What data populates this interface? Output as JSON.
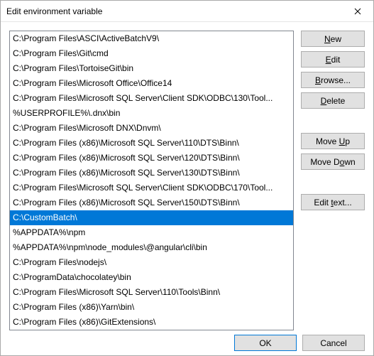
{
  "window": {
    "title": "Edit environment variable"
  },
  "paths": [
    {
      "text": "C:\\Program Files\\ASCI\\ActiveBatchV9\\",
      "selected": false
    },
    {
      "text": "C:\\Program Files\\Git\\cmd",
      "selected": false
    },
    {
      "text": "C:\\Program Files\\TortoiseGit\\bin",
      "selected": false
    },
    {
      "text": "C:\\Program Files\\Microsoft Office\\Office14",
      "selected": false
    },
    {
      "text": "C:\\Program Files\\Microsoft SQL Server\\Client SDK\\ODBC\\130\\Tool...",
      "selected": false
    },
    {
      "text": "%USERPROFILE%\\.dnx\\bin",
      "selected": false
    },
    {
      "text": "C:\\Program Files\\Microsoft DNX\\Dnvm\\",
      "selected": false
    },
    {
      "text": "C:\\Program Files (x86)\\Microsoft SQL Server\\110\\DTS\\Binn\\",
      "selected": false
    },
    {
      "text": "C:\\Program Files (x86)\\Microsoft SQL Server\\120\\DTS\\Binn\\",
      "selected": false
    },
    {
      "text": "C:\\Program Files (x86)\\Microsoft SQL Server\\130\\DTS\\Binn\\",
      "selected": false
    },
    {
      "text": "C:\\Program Files\\Microsoft SQL Server\\Client SDK\\ODBC\\170\\Tool...",
      "selected": false
    },
    {
      "text": "C:\\Program Files (x86)\\Microsoft SQL Server\\150\\DTS\\Binn\\",
      "selected": false
    },
    {
      "text": "C:\\CustomBatch\\",
      "selected": true
    },
    {
      "text": "%APPDATA%\\npm",
      "selected": false
    },
    {
      "text": "%APPDATA%\\npm\\node_modules\\@angular\\cli\\bin",
      "selected": false
    },
    {
      "text": "C:\\Program Files\\nodejs\\",
      "selected": false
    },
    {
      "text": "C:\\ProgramData\\chocolatey\\bin",
      "selected": false
    },
    {
      "text": "C:\\Program Files\\Microsoft SQL Server\\110\\Tools\\Binn\\",
      "selected": false
    },
    {
      "text": "C:\\Program Files (x86)\\Yarn\\bin\\",
      "selected": false
    },
    {
      "text": "C:\\Program Files (x86)\\GitExtensions\\",
      "selected": false
    }
  ],
  "buttons": {
    "new_pre": "",
    "new_accel": "N",
    "new_post": "ew",
    "edit_pre": "",
    "edit_accel": "E",
    "edit_post": "dit",
    "browse_pre": "",
    "browse_accel": "B",
    "browse_post": "rowse...",
    "delete_pre": "",
    "delete_accel": "D",
    "delete_post": "elete",
    "moveup_pre": "Move ",
    "moveup_accel": "U",
    "moveup_post": "p",
    "movedown_pre": "Move D",
    "movedown_accel": "o",
    "movedown_post": "wn",
    "edittext_pre": "Edit ",
    "edittext_accel": "t",
    "edittext_post": "ext...",
    "ok": "OK",
    "cancel": "Cancel"
  }
}
